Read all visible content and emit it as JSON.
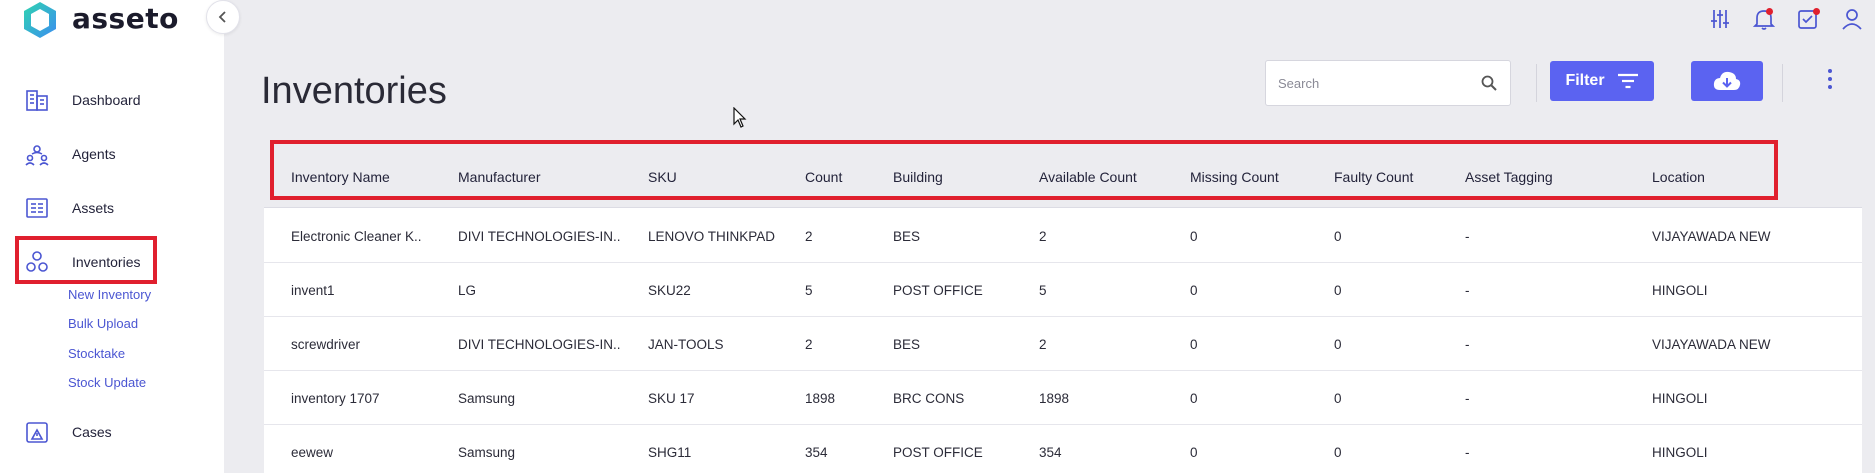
{
  "app": {
    "name": "asseto"
  },
  "sidebar": {
    "items": [
      {
        "label": "Dashboard",
        "icon": "building-icon"
      },
      {
        "label": "Agents",
        "icon": "agents-icon"
      },
      {
        "label": "Assets",
        "icon": "assets-icon"
      },
      {
        "label": "Inventories",
        "icon": "inventories-icon",
        "active": true
      },
      {
        "label": "Cases",
        "icon": "cases-icon"
      }
    ],
    "subitems": [
      "New Inventory",
      "Bulk Upload",
      "Stocktake",
      "Stock Update"
    ]
  },
  "header": {
    "title": "Inventories",
    "search_placeholder": "Search",
    "filter_label": "Filter"
  },
  "top_icons": [
    "sliders-icon",
    "bell-icon",
    "tasks-icon",
    "user-icon"
  ],
  "table": {
    "columns": [
      "Inventory Name",
      "Manufacturer",
      "SKU",
      "Count",
      "Building",
      "Available Count",
      "Missing Count",
      "Faulty Count",
      "Asset Tagging",
      "Location"
    ],
    "rows": [
      [
        "Electronic Cleaner K..",
        "DIVI TECHNOLOGIES-IN..",
        "LENOVO THINKPAD",
        "2",
        "BES",
        "2",
        "0",
        "0",
        "-",
        "VIJAYAWADA NEW"
      ],
      [
        "invent1",
        "LG",
        "SKU22",
        "5",
        "POST OFFICE",
        "5",
        "0",
        "0",
        "-",
        "HINGOLI"
      ],
      [
        "screwdriver",
        "DIVI TECHNOLOGIES-IN..",
        "JAN-TOOLS",
        "2",
        "BES",
        "2",
        "0",
        "0",
        "-",
        "VIJAYAWADA NEW"
      ],
      [
        "inventory 1707",
        "Samsung",
        "SKU 17",
        "1898",
        "BRC CONS",
        "1898",
        "0",
        "0",
        "-",
        "HINGOLI"
      ],
      [
        "eewew",
        "Samsung",
        "SHG11",
        "354",
        "POST OFFICE",
        "354",
        "0",
        "0",
        "-",
        "HINGOLI"
      ]
    ]
  },
  "colors": {
    "accent": "#5b63f1",
    "highlight": "#e0202e",
    "link": "#4b56d2"
  }
}
